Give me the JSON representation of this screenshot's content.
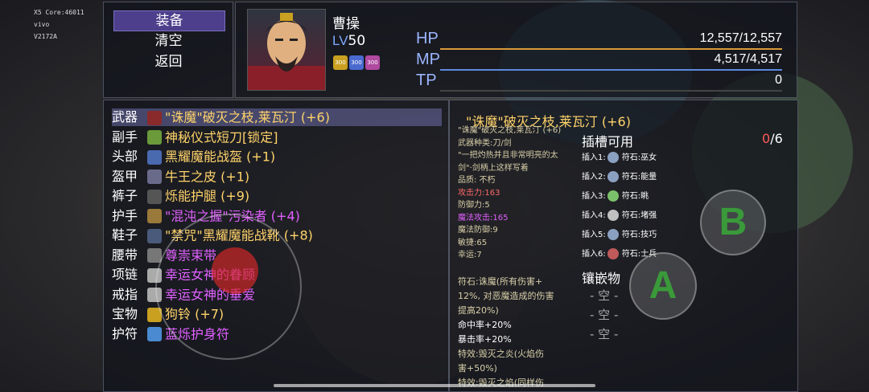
{
  "debug": {
    "line1": "X5  Core:46011",
    "line2": "vivo",
    "line3": "V2172A"
  },
  "menu": {
    "items": [
      "装备",
      "清空",
      "返回"
    ],
    "selected": 0
  },
  "character": {
    "name": "曹操",
    "level_prefix": "LV",
    "level": "50",
    "badges": [
      {
        "text": "300",
        "color": "#c9a020"
      },
      {
        "text": "300",
        "color": "#4a6ad0"
      },
      {
        "text": "300",
        "color": "#b04aa0"
      }
    ]
  },
  "stats": [
    {
      "label": "HP",
      "value": "12,557/12,557",
      "bar_color": "#d89a3a"
    },
    {
      "label": "MP",
      "value": "4,517/4,517",
      "bar_color": "#5b8ae0"
    },
    {
      "label": "TP",
      "value": "0",
      "bar_color": "#444"
    }
  ],
  "equipment": [
    {
      "slot": "武器",
      "name": "\"诛魔\"破灭之枝,莱瓦汀 (+6)",
      "color": "#ffd36a",
      "icon": "sword-icon",
      "icon_color": "#8a2a2a"
    },
    {
      "slot": "副手",
      "name": "神秘仪式短刀[锁定]",
      "color": "#ffd36a",
      "icon": "dagger-icon",
      "icon_color": "#6a9a3a"
    },
    {
      "slot": "头部",
      "name": "黑耀魔能战盔 (+1)",
      "color": "#ffd36a",
      "icon": "helmet-icon",
      "icon_color": "#4a6ab0"
    },
    {
      "slot": "盔甲",
      "name": "牛王之皮 (+1)",
      "color": "#ffd36a",
      "icon": "armor-icon",
      "icon_color": "#6a6a8a"
    },
    {
      "slot": "裤子",
      "name": "烁能护腿 (+9)",
      "color": "#ffd36a",
      "icon": "greaves-icon",
      "icon_color": "#555"
    },
    {
      "slot": "护手",
      "name": "\"混沌之握\"污染者 (+4)",
      "color": "#e060ff",
      "icon": "gauntlet-icon",
      "icon_color": "#9a7a3a"
    },
    {
      "slot": "鞋子",
      "name": "\"禁咒\"黑耀魔能战靴 (+8)",
      "color": "#ffd36a",
      "icon": "boots-icon",
      "icon_color": "#4a5a7a"
    },
    {
      "slot": "腰带",
      "name": "尊崇束带",
      "color": "#e060ff",
      "icon": "belt-icon",
      "icon_color": "#777"
    },
    {
      "slot": "项链",
      "name": "幸运女神的眷顾",
      "color": "#e060ff",
      "icon": "necklace-icon",
      "icon_color": "#aaa"
    },
    {
      "slot": "戒指",
      "name": "幸运女神的垂爱",
      "color": "#e060ff",
      "icon": "ring-icon",
      "icon_color": "#aaa"
    },
    {
      "slot": "宝物",
      "name": "狗铃 (+7)",
      "color": "#ffd36a",
      "icon": "bell-icon",
      "icon_color": "#c9a020"
    },
    {
      "slot": "护符",
      "name": "蓝烁护身符",
      "color": "#e060ff",
      "icon": "amulet-icon",
      "icon_color": "#4a8ad0"
    }
  ],
  "detail": {
    "title": "\"诛魔\"破灭之枝,莱瓦汀 (+6)",
    "lines": [
      {
        "text": "\"诛魔\"破灭之枝,莱瓦汀 (+6)",
        "color": "#d8cfa8"
      },
      {
        "text": "武器种类:刀/剑",
        "color": "#d8cfa8"
      },
      {
        "text": "\"一把灼热并且非常明亮的太",
        "color": "#d8cfa8"
      },
      {
        "text": "剑\"·剑柄上这样写着",
        "color": "#d8cfa8"
      },
      {
        "text": "品质: 不朽",
        "color": "#d8cfa8"
      },
      {
        "text": "攻击力:163",
        "color": "#ff6a6a"
      },
      {
        "text": "防御力:5",
        "color": "#d8cfa8"
      },
      {
        "text": "魔法攻击:165",
        "color": "#e060ff"
      },
      {
        "text": "魔法防御:9",
        "color": "#d8cfa8"
      },
      {
        "text": "敏捷:65",
        "color": "#d8cfa8"
      },
      {
        "text": "幸运:7",
        "color": "#d8cfa8"
      }
    ],
    "special_lines": [
      {
        "text": "符石:诛魔(所有伤害+",
        "color": "#d8cfa8"
      },
      {
        "text": "12%, 对恶魔造成的伤害",
        "color": "#d8cfa8"
      },
      {
        "text": "提高20%)",
        "color": "#d8cfa8"
      },
      {
        "text": "命中率+20%",
        "color": "#ffffff"
      },
      {
        "text": "暴击率+20%",
        "color": "#ffffff"
      },
      {
        "text": "特效:毁灭之炎(火焰伤",
        "color": "#d8cfa8"
      },
      {
        "text": "害+50%)",
        "color": "#d8cfa8"
      },
      {
        "text": "特效:毁灭之焰(同样伤",
        "color": "#d8cfa8"
      }
    ],
    "socket_head": "插槽可用",
    "socket_used": "0",
    "socket_total": "/6",
    "sockets": [
      {
        "label": "插入1:",
        "gem": "符石:巫女",
        "color": "#8aa0c0"
      },
      {
        "label": "插入2:",
        "gem": "符石:能量",
        "color": "#8aa0c0"
      },
      {
        "label": "插入3:",
        "gem": "符石:眺",
        "color": "#7ac06a"
      },
      {
        "label": "插入4:",
        "gem": "符石:堵强",
        "color": "#c0c0c0"
      },
      {
        "label": "插入5:",
        "gem": "符石:技巧",
        "color": "#8aa0c0"
      },
      {
        "label": "插入6:",
        "gem": "符石:士兵",
        "color": "#c05a5a"
      }
    ],
    "inlay_head": "镶嵌物",
    "inlay_slots": [
      "- 空 -",
      "- 空 -",
      "- 空 -"
    ]
  },
  "controls": {
    "b_label": "B",
    "a_label": "A"
  }
}
